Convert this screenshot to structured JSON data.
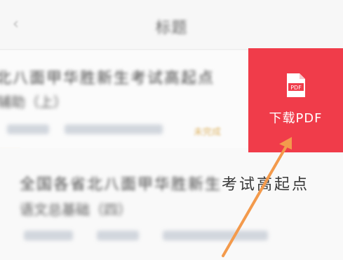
{
  "header": {
    "back_glyph": "‹",
    "title": "标题"
  },
  "items": [
    {
      "title_line1": "北八面甲华胜新生考试高起点",
      "title_line2": "辅助（上）",
      "meta_left": "",
      "meta_right": "",
      "status": "未完成"
    },
    {
      "title_line1_blurred": "全国各省北八面甲华胜新生",
      "title_line1_clear": "考试高起点",
      "title_line2": "语文总基础（四）"
    }
  ],
  "download_action": {
    "icon_text": "PDF",
    "label": "下载PDF",
    "background": "#f03c4a"
  },
  "annotation_arrow": {
    "color": "#f39a4c"
  }
}
